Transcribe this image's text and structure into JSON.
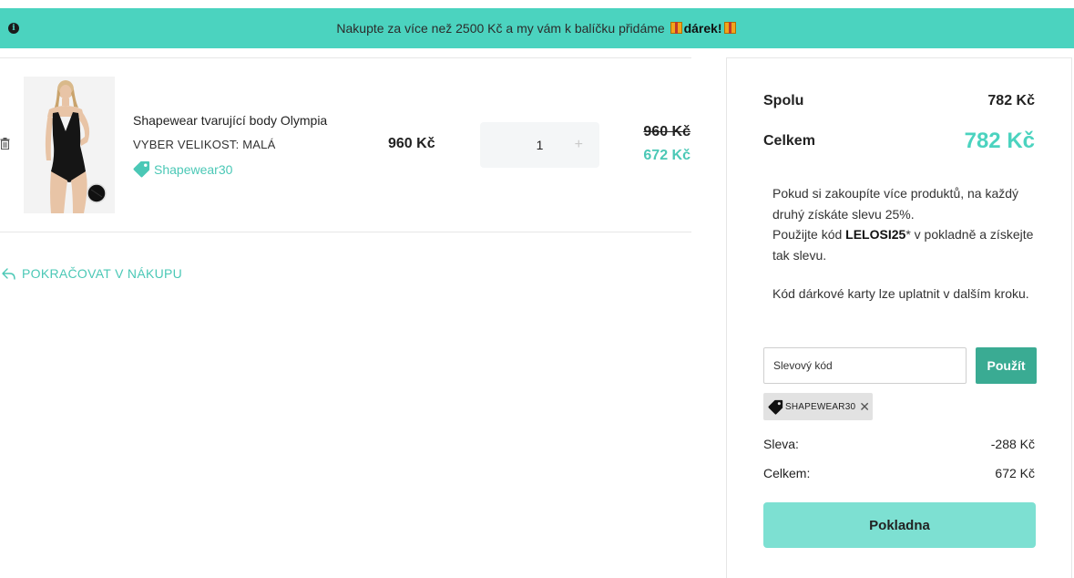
{
  "banner": {
    "message_prefix": "Nakupte za více než 2500 Kč a my vám k balíčku přidáme ",
    "message_bold": "dárek!",
    "icon": "info-icon",
    "gift_icon": "gift-icon",
    "color": "#4bd3bf"
  },
  "cart": {
    "item": {
      "name": "Shapewear tvarující body Olympia",
      "variant": "VYBER VELIKOST: MALÁ",
      "coupon_tag": "Shapewear30",
      "unit_price": "960 Kč",
      "quantity": "1",
      "plus_symbol": "+",
      "old_total": "960 Kč",
      "new_total": "672 Kč"
    },
    "continue_label": "POKRAČOVAT V NÁKUPU"
  },
  "summary": {
    "subtotal_label": "Spolu",
    "subtotal_value": "782 Kč",
    "total_label": "Celkem",
    "total_value": "782 Kč",
    "promo_line1": "Pokud si zakoupíte více produktů, na každý druhý získáte slevu 25%.",
    "promo_line2_prefix": "Použijte kód ",
    "promo_code": "LELOSI25",
    "promo_line2_suffix": "* v pokladně a získejte tak slevu.",
    "gift_card_note": "Kód dárkové karty lze uplatnit v dalším kroku.",
    "coupon_placeholder": "Slevový kód",
    "apply_label": "Použít",
    "applied_coupon": "SHAPEWEAR30",
    "remove_symbol": "✕",
    "discount_label": "Sleva:",
    "discount_value": "-288 Kč",
    "final_label": "Celkem:",
    "final_value": "672 Kč",
    "checkout_label": "Pokladna",
    "accent_color": "#4bd3bf"
  }
}
